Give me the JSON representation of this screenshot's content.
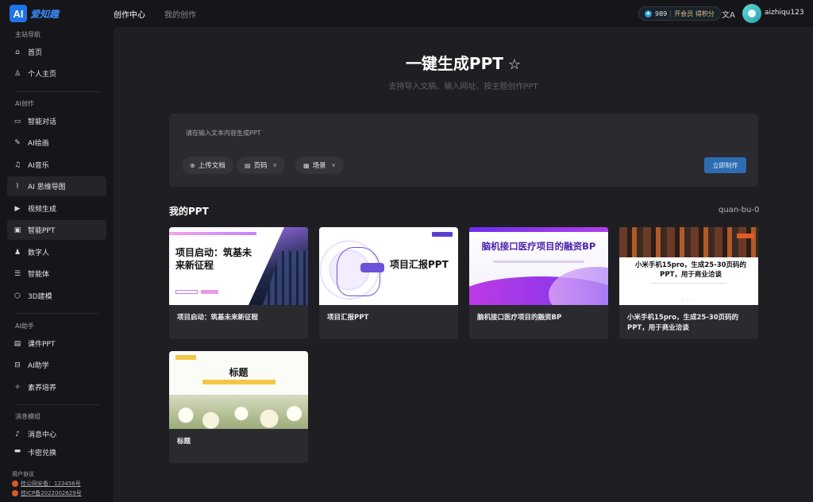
{
  "app": {
    "logo_mark": "AI",
    "logo_text": "爱知趣"
  },
  "topnav": {
    "items": [
      {
        "label": "创作中心",
        "active": true
      },
      {
        "label": "我的创作",
        "active": false
      }
    ]
  },
  "account": {
    "points": "989",
    "vip_label": "开会员 得积分",
    "translate_icon": "文A",
    "username": "aizhiqu123"
  },
  "sidebar": {
    "sections": [
      {
        "title": "主站导航",
        "items": [
          {
            "label": "首页",
            "icon": "home-icon",
            "glyph": "⌂"
          },
          {
            "label": "个人主页",
            "icon": "user-icon",
            "glyph": "♙"
          }
        ]
      },
      {
        "title": "AI创作",
        "items": [
          {
            "label": "智能对话",
            "icon": "chat-icon",
            "glyph": "▭"
          },
          {
            "label": "AI绘画",
            "icon": "pen-icon",
            "glyph": "✎"
          },
          {
            "label": "AI音乐",
            "icon": "music-icon",
            "glyph": "♫"
          },
          {
            "label": "AI 思维导图",
            "icon": "chart-icon",
            "glyph": "⌇"
          },
          {
            "label": "视频生成",
            "icon": "play-icon",
            "glyph": "▶"
          },
          {
            "label": "智能PPT",
            "icon": "ppt-icon",
            "glyph": "▣"
          },
          {
            "label": "数字人",
            "icon": "person-icon",
            "glyph": "♟"
          },
          {
            "label": "智能体",
            "icon": "list-icon",
            "glyph": "☰"
          },
          {
            "label": "3D建模",
            "icon": "cube-icon",
            "glyph": "⬡"
          }
        ]
      },
      {
        "title": "AI助手",
        "items": [
          {
            "label": "课件PPT",
            "icon": "board-icon",
            "glyph": "▤"
          },
          {
            "label": "AI助学",
            "icon": "desk-icon",
            "glyph": "⊟"
          },
          {
            "label": "素养培养",
            "icon": "bulb-icon",
            "glyph": "✧"
          }
        ]
      },
      {
        "title": "消息模组",
        "items": [
          {
            "label": "消息中心",
            "icon": "bell-icon",
            "glyph": "♪"
          },
          {
            "label": "卡密兑换",
            "icon": "card-icon",
            "glyph": "▬"
          }
        ]
      }
    ],
    "footer": {
      "title": "用户协议",
      "links": [
        "桂公网安备：123456号",
        "桂ICP备2022002629号"
      ]
    }
  },
  "hero": {
    "title": "一键生成PPT",
    "star_icon": "☆",
    "subtitle": "支持导入文稿、输入网址、按主题创作PPT"
  },
  "composer": {
    "placeholder": "请在输入文本内容生成PPT",
    "upload_label": "上传文档",
    "pages_label": "页码",
    "scene_label": "场景",
    "submit_label": "立即制作"
  },
  "ppt_section": {
    "title": "我的PPT",
    "right_text": "quan-bu-0",
    "cards": [
      {
        "caption": "项目启动：筑基未来新征程",
        "thumb_title": "项目启动：筑基未来新征程"
      },
      {
        "caption": "项目汇报PPT",
        "thumb_title": "项目汇报PPT"
      },
      {
        "caption": "脑机接口医疗项目的融资BP",
        "thumb_title": "脑机接口医疗项目的融资BP"
      },
      {
        "caption": "小米手机15pro，生成25-30页码的PPT，用于商业洽谈",
        "thumb_title": "小米手机15pro，生成25-30页码的PPT，用于商业洽谈"
      },
      {
        "caption": "标题",
        "thumb_title": "标题"
      }
    ]
  }
}
